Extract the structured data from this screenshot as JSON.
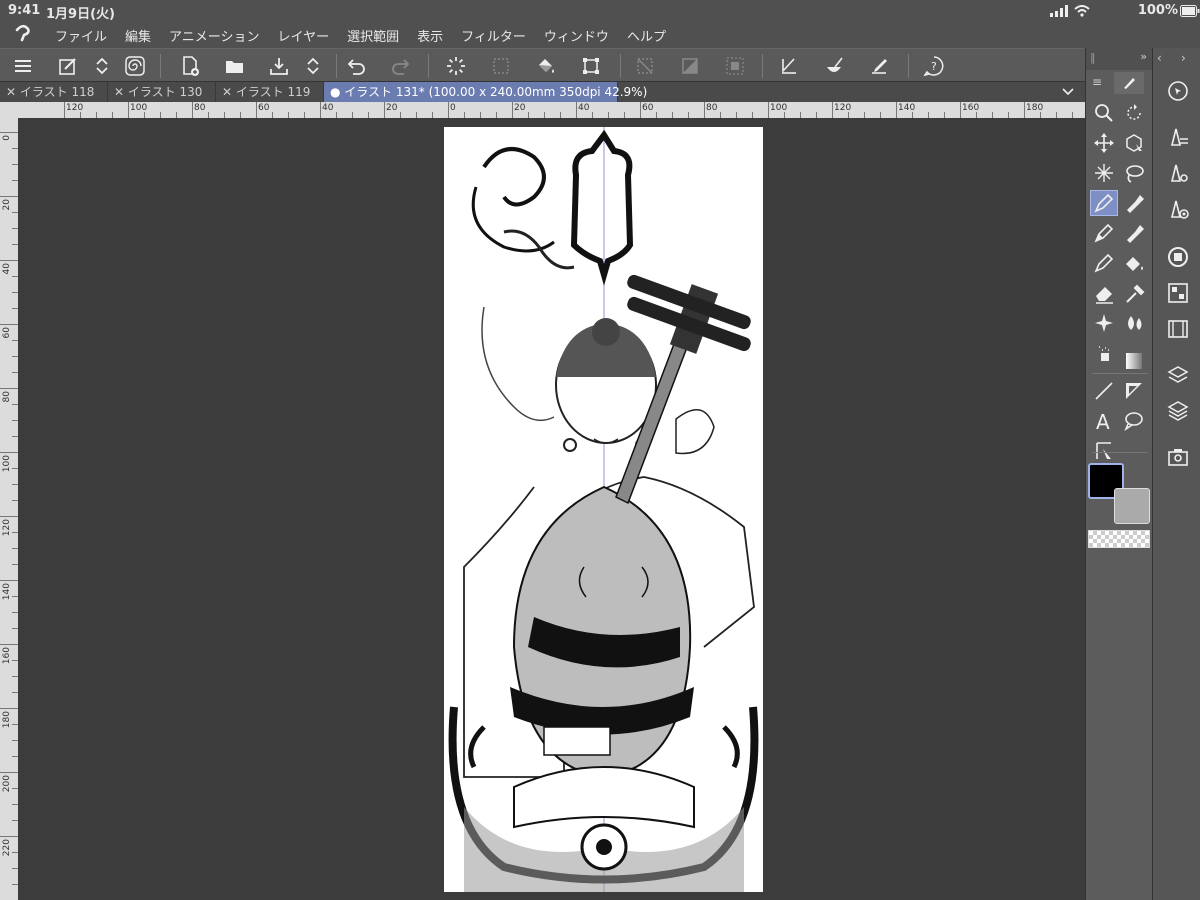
{
  "status": {
    "time": "9:41",
    "date": "1月9日(火)",
    "battery": "100%"
  },
  "menu": [
    "ファイル",
    "編集",
    "アニメーション",
    "レイヤー",
    "選択範囲",
    "表示",
    "フィルター",
    "ウィンドウ",
    "ヘルプ"
  ],
  "tabs": [
    {
      "label": "イラスト 118",
      "active": false
    },
    {
      "label": "イラスト 130",
      "active": false
    },
    {
      "label": "イラスト 119",
      "active": false
    },
    {
      "label": "イラスト 131* (100.00 x 240.00mm 350dpi 42.9%)",
      "active": true
    }
  ],
  "ruler": {
    "top_labels": [
      "120",
      "100",
      "80",
      "60",
      "40",
      "20",
      "0",
      "20",
      "40",
      "60",
      "80",
      "100",
      "120",
      "140",
      "160",
      "180"
    ],
    "left_labels": [
      "0",
      "20",
      "40",
      "60",
      "80",
      "100",
      "120",
      "140",
      "160",
      "180",
      "200",
      "220"
    ]
  },
  "colors": {
    "main": "#000000",
    "sub": "#aaaaaa",
    "accent": "#7d8fc4",
    "active_tab": "#6b7cb0"
  },
  "canvas": {
    "description_icon": "biwa-player-illustration-icon"
  }
}
